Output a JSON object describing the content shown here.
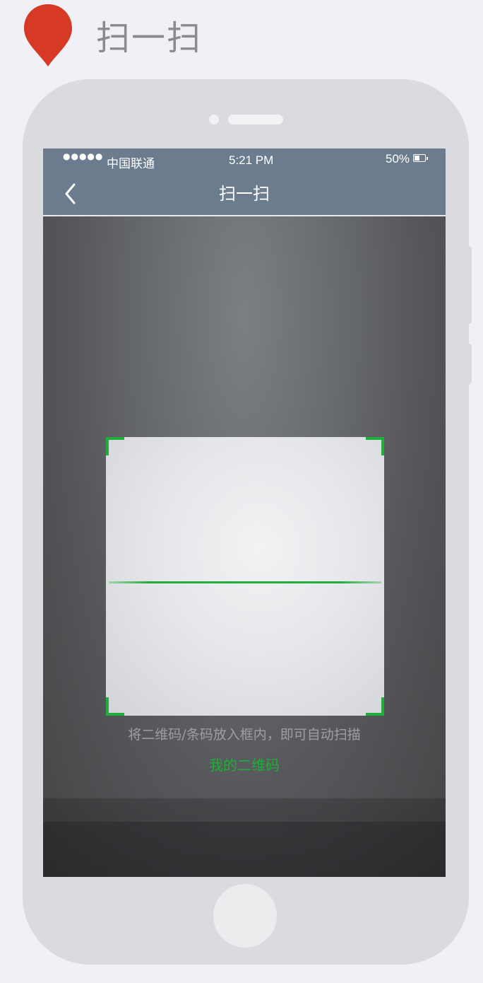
{
  "header": {
    "title": "扫一扫",
    "icon": "map-pin-icon",
    "icon_color": "#d63a25"
  },
  "status_bar": {
    "signal": "●●●●●",
    "carrier": "中国联通",
    "time": "5:21 PM",
    "battery": "50%"
  },
  "nav": {
    "back_icon": "chevron-left-icon",
    "title": "扫一扫"
  },
  "scanner": {
    "hint": "将二维码/条码放入框内，即可自动扫描",
    "my_qr_label": "我的二维码",
    "accent_color": "#1fae3a"
  }
}
